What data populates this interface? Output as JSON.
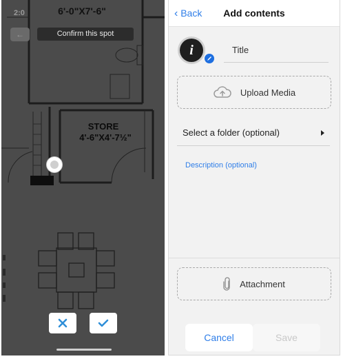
{
  "left_panel": {
    "status_time": "2:0",
    "dimension_label": "6'-0\"X7'-6\"",
    "back_icon": "arrow-left-icon",
    "confirm_text": "Confirm this spot",
    "room_name": "STORE",
    "room_dimensions": "4'-6\"X4'-7½\"",
    "cancel_icon": "close-icon",
    "confirm_icon": "check-icon",
    "accent_color": "#2f8fd8"
  },
  "right_panel": {
    "nav": {
      "back_label": "Back",
      "title": "Add contents"
    },
    "info_icon": "info-icon",
    "edit_icon": "pencil-icon",
    "title_placeholder": "Title",
    "upload_label": "Upload Media",
    "upload_icon": "cloud-upload-icon",
    "folder_label": "Select a folder (optional)",
    "folder_caret_icon": "caret-right-icon",
    "description_placeholder": "Description (optional)",
    "attachment_label": "Attachment",
    "attachment_icon": "paperclip-icon",
    "cancel_label": "Cancel",
    "save_label": "Save",
    "link_color": "#2f7ee8"
  }
}
